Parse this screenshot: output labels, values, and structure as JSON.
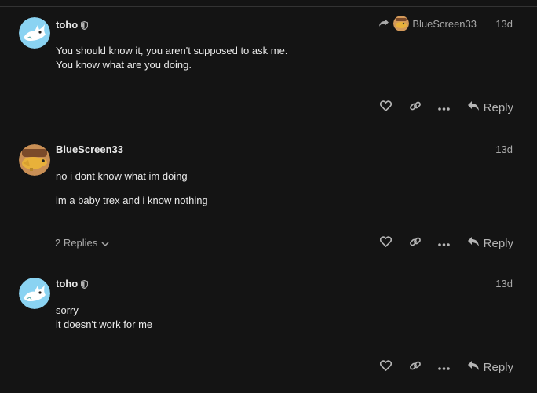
{
  "posts": [
    {
      "username": "toho",
      "date": "13d",
      "reply_to": "BlueScreen33",
      "lines": [
        "You should know it, you aren't supposed to ask me.",
        "You know what are you doing."
      ],
      "reply_label": "Reply"
    },
    {
      "username": "BlueScreen33",
      "date": "13d",
      "paragraphs": [
        "no i dont know what im doing",
        "im a baby trex and i know nothing"
      ],
      "replies_label": "2 Replies",
      "reply_label": "Reply"
    },
    {
      "username": "toho",
      "date": "13d",
      "lines": [
        "sorry",
        "it doesn't work for me"
      ],
      "reply_label": "Reply"
    }
  ],
  "icons": {
    "like": "heart-icon",
    "link": "link-icon",
    "more": "ellipsis-icon",
    "reply": "reply-arrow-icon",
    "shield": "shield-icon",
    "replies_toggle": "chevron-down-icon"
  },
  "colors": {
    "background": "#141414",
    "divider": "#333333",
    "text": "#e6e6e6",
    "muted": "#a9a9a9",
    "shark_avatar_bg": "#8ad3f2",
    "trex_avatar_bg": "#d49a5a"
  }
}
